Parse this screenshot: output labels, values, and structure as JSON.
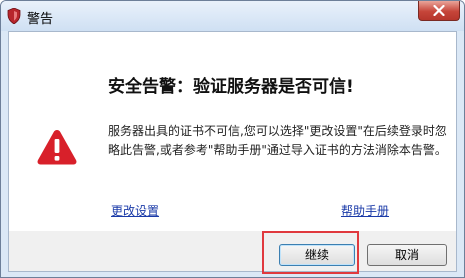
{
  "window": {
    "title": "警告",
    "accent": "#c6453a"
  },
  "dialog": {
    "headline": "安全告警：验证服务器是否可信!",
    "message": "服务器出具的证书不可信,您可以选择\"更改设置\"在后续登录时忽略此告警,或者参考\"帮助手册\"通过导入证书的方法消除本告警。",
    "icon": "warning-triangle-icon",
    "icon_color": "#d8202a"
  },
  "links": {
    "change_settings": "更改设置",
    "help_manual": "帮助手册",
    "color": "#1a3aa8"
  },
  "buttons": {
    "continue": "继续",
    "cancel": "取消"
  },
  "annotation": {
    "highlight_color": "#e0393e"
  }
}
